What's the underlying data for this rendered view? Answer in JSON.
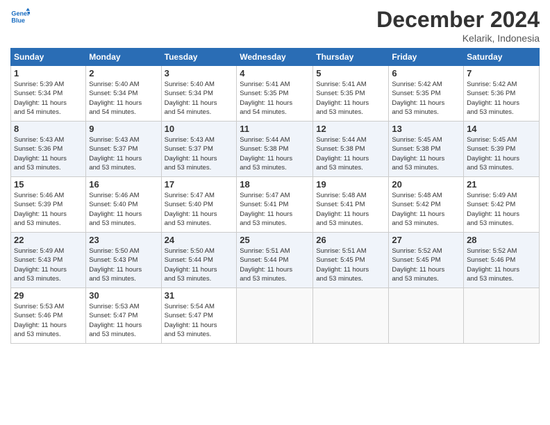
{
  "header": {
    "logo_line1": "General",
    "logo_line2": "Blue",
    "month": "December 2024",
    "location": "Kelarik, Indonesia"
  },
  "weekdays": [
    "Sunday",
    "Monday",
    "Tuesday",
    "Wednesday",
    "Thursday",
    "Friday",
    "Saturday"
  ],
  "weeks": [
    [
      {
        "day": "1",
        "info": "Sunrise: 5:39 AM\nSunset: 5:34 PM\nDaylight: 11 hours\nand 54 minutes."
      },
      {
        "day": "2",
        "info": "Sunrise: 5:40 AM\nSunset: 5:34 PM\nDaylight: 11 hours\nand 54 minutes."
      },
      {
        "day": "3",
        "info": "Sunrise: 5:40 AM\nSunset: 5:34 PM\nDaylight: 11 hours\nand 54 minutes."
      },
      {
        "day": "4",
        "info": "Sunrise: 5:41 AM\nSunset: 5:35 PM\nDaylight: 11 hours\nand 54 minutes."
      },
      {
        "day": "5",
        "info": "Sunrise: 5:41 AM\nSunset: 5:35 PM\nDaylight: 11 hours\nand 53 minutes."
      },
      {
        "day": "6",
        "info": "Sunrise: 5:42 AM\nSunset: 5:35 PM\nDaylight: 11 hours\nand 53 minutes."
      },
      {
        "day": "7",
        "info": "Sunrise: 5:42 AM\nSunset: 5:36 PM\nDaylight: 11 hours\nand 53 minutes."
      }
    ],
    [
      {
        "day": "8",
        "info": "Sunrise: 5:43 AM\nSunset: 5:36 PM\nDaylight: 11 hours\nand 53 minutes."
      },
      {
        "day": "9",
        "info": "Sunrise: 5:43 AM\nSunset: 5:37 PM\nDaylight: 11 hours\nand 53 minutes."
      },
      {
        "day": "10",
        "info": "Sunrise: 5:43 AM\nSunset: 5:37 PM\nDaylight: 11 hours\nand 53 minutes."
      },
      {
        "day": "11",
        "info": "Sunrise: 5:44 AM\nSunset: 5:38 PM\nDaylight: 11 hours\nand 53 minutes."
      },
      {
        "day": "12",
        "info": "Sunrise: 5:44 AM\nSunset: 5:38 PM\nDaylight: 11 hours\nand 53 minutes."
      },
      {
        "day": "13",
        "info": "Sunrise: 5:45 AM\nSunset: 5:38 PM\nDaylight: 11 hours\nand 53 minutes."
      },
      {
        "day": "14",
        "info": "Sunrise: 5:45 AM\nSunset: 5:39 PM\nDaylight: 11 hours\nand 53 minutes."
      }
    ],
    [
      {
        "day": "15",
        "info": "Sunrise: 5:46 AM\nSunset: 5:39 PM\nDaylight: 11 hours\nand 53 minutes."
      },
      {
        "day": "16",
        "info": "Sunrise: 5:46 AM\nSunset: 5:40 PM\nDaylight: 11 hours\nand 53 minutes."
      },
      {
        "day": "17",
        "info": "Sunrise: 5:47 AM\nSunset: 5:40 PM\nDaylight: 11 hours\nand 53 minutes."
      },
      {
        "day": "18",
        "info": "Sunrise: 5:47 AM\nSunset: 5:41 PM\nDaylight: 11 hours\nand 53 minutes."
      },
      {
        "day": "19",
        "info": "Sunrise: 5:48 AM\nSunset: 5:41 PM\nDaylight: 11 hours\nand 53 minutes."
      },
      {
        "day": "20",
        "info": "Sunrise: 5:48 AM\nSunset: 5:42 PM\nDaylight: 11 hours\nand 53 minutes."
      },
      {
        "day": "21",
        "info": "Sunrise: 5:49 AM\nSunset: 5:42 PM\nDaylight: 11 hours\nand 53 minutes."
      }
    ],
    [
      {
        "day": "22",
        "info": "Sunrise: 5:49 AM\nSunset: 5:43 PM\nDaylight: 11 hours\nand 53 minutes."
      },
      {
        "day": "23",
        "info": "Sunrise: 5:50 AM\nSunset: 5:43 PM\nDaylight: 11 hours\nand 53 minutes."
      },
      {
        "day": "24",
        "info": "Sunrise: 5:50 AM\nSunset: 5:44 PM\nDaylight: 11 hours\nand 53 minutes."
      },
      {
        "day": "25",
        "info": "Sunrise: 5:51 AM\nSunset: 5:44 PM\nDaylight: 11 hours\nand 53 minutes."
      },
      {
        "day": "26",
        "info": "Sunrise: 5:51 AM\nSunset: 5:45 PM\nDaylight: 11 hours\nand 53 minutes."
      },
      {
        "day": "27",
        "info": "Sunrise: 5:52 AM\nSunset: 5:45 PM\nDaylight: 11 hours\nand 53 minutes."
      },
      {
        "day": "28",
        "info": "Sunrise: 5:52 AM\nSunset: 5:46 PM\nDaylight: 11 hours\nand 53 minutes."
      }
    ],
    [
      {
        "day": "29",
        "info": "Sunrise: 5:53 AM\nSunset: 5:46 PM\nDaylight: 11 hours\nand 53 minutes."
      },
      {
        "day": "30",
        "info": "Sunrise: 5:53 AM\nSunset: 5:47 PM\nDaylight: 11 hours\nand 53 minutes."
      },
      {
        "day": "31",
        "info": "Sunrise: 5:54 AM\nSunset: 5:47 PM\nDaylight: 11 hours\nand 53 minutes."
      },
      {
        "day": "",
        "info": ""
      },
      {
        "day": "",
        "info": ""
      },
      {
        "day": "",
        "info": ""
      },
      {
        "day": "",
        "info": ""
      }
    ]
  ]
}
